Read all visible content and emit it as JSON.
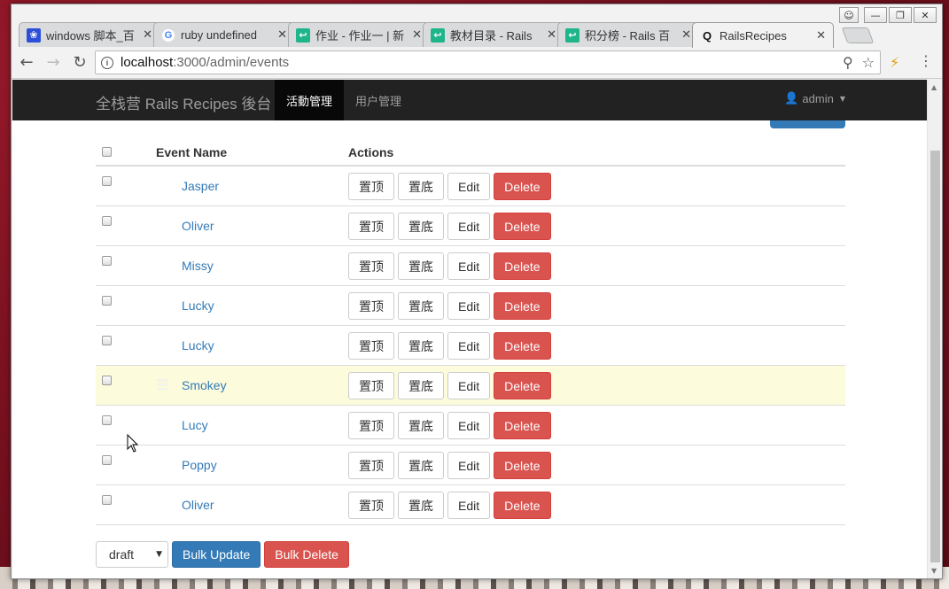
{
  "browser": {
    "tabs": [
      {
        "title": "windows 脚本_百",
        "favicon": "paw-icon"
      },
      {
        "title": "ruby undefined",
        "favicon": "google-icon"
      },
      {
        "title": "作业 - 作业一 | 新",
        "favicon": "green-book-icon"
      },
      {
        "title": "教材目录 - Rails",
        "favicon": "green-book-icon"
      },
      {
        "title": "积分榜 - Rails 百",
        "favicon": "green-book-icon"
      },
      {
        "title": "RailsRecipes",
        "favicon": "q-icon",
        "active": true
      }
    ],
    "url_host": "localhost",
    "url_path": ":3000/admin/events",
    "accent": "#337ab7"
  },
  "navbar": {
    "brand": "全栈营 Rails Recipes 後台",
    "items": [
      {
        "label": "活動管理",
        "active": true
      },
      {
        "label": "用户管理",
        "active": false
      }
    ],
    "user": "admin"
  },
  "table": {
    "headers": {
      "name": "Event Name",
      "actions": "Actions"
    },
    "rows": [
      {
        "name": "Jasper"
      },
      {
        "name": "Oliver"
      },
      {
        "name": "Missy"
      },
      {
        "name": "Lucky"
      },
      {
        "name": "Lucky"
      },
      {
        "name": "Smokey",
        "highlighted": true
      },
      {
        "name": "Lucy"
      },
      {
        "name": "Poppy"
      },
      {
        "name": "Oliver"
      }
    ],
    "action_labels": {
      "top": "置顶",
      "bottom": "置底",
      "edit": "Edit",
      "delete": "Delete"
    }
  },
  "bulk": {
    "status_selected": "draft",
    "update_label": "Bulk Update",
    "delete_label": "Bulk Delete"
  }
}
